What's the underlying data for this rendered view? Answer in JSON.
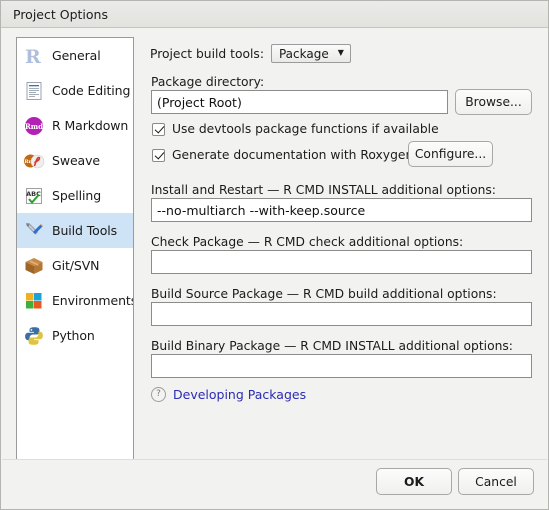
{
  "window": {
    "title": "Project Options"
  },
  "sidebar": {
    "items": [
      {
        "label": "General",
        "icon": "r-logo-icon",
        "selected": false
      },
      {
        "label": "Code Editing",
        "icon": "document-icon",
        "selected": false
      },
      {
        "label": "R Markdown",
        "icon": "rmd-badge-icon",
        "selected": false
      },
      {
        "label": "Sweave",
        "icon": "sweave-pdf-icon",
        "selected": false
      },
      {
        "label": "Spelling",
        "icon": "abc-check-icon",
        "selected": false
      },
      {
        "label": "Build Tools",
        "icon": "wrench-tools-icon",
        "selected": true
      },
      {
        "label": "Git/SVN",
        "icon": "package-box-icon",
        "selected": false
      },
      {
        "label": "Environments",
        "icon": "color-squares-icon",
        "selected": false
      },
      {
        "label": "Python",
        "icon": "python-icon",
        "selected": false
      }
    ]
  },
  "pane": {
    "build_tools_label": "Project build tools:",
    "build_tools_value": "Package",
    "build_tools_caret": "▼",
    "package_dir_label": "Package directory:",
    "package_dir_value": "(Project Root)",
    "browse_label": "Browse...",
    "devtools_checkbox_label": "Use devtools package functions if available",
    "devtools_checked": true,
    "roxygen_checkbox_label": "Generate documentation with Roxygen",
    "roxygen_checked": true,
    "configure_label": "Configure...",
    "install_label": "Install and Restart — R CMD INSTALL additional options:",
    "install_value": "--no-multiarch --with-keep.source",
    "check_label": "Check Package — R CMD check additional options:",
    "check_value": "",
    "build_source_label": "Build Source Package — R CMD build additional options:",
    "build_source_value": "",
    "build_binary_label": "Build Binary Package — R CMD INSTALL additional options:",
    "build_binary_value": "",
    "help_icon": "question-mark-icon",
    "help_link_label": "Developing Packages"
  },
  "footer": {
    "ok_label": "OK",
    "cancel_label": "Cancel"
  },
  "colors": {
    "selection_blue": "#cfe3f7",
    "link_blue": "#2b2bb5",
    "window_bg": "#f2f2f0",
    "field_bg": "#ffffff"
  }
}
